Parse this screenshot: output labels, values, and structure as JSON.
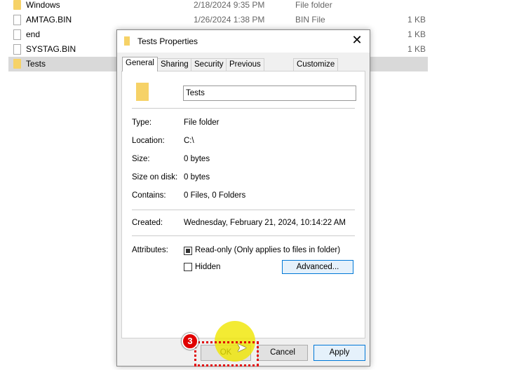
{
  "explorer": {
    "rows": [
      {
        "name": "Windows",
        "date": "2/18/2024 9:35 PM",
        "type": "File folder",
        "size": "",
        "icon": "folder-icon"
      },
      {
        "name": "AMTAG.BIN",
        "date": "1/26/2024 1:38 PM",
        "type": "BIN File",
        "size": "1 KB",
        "icon": "file-icon"
      },
      {
        "name": "end",
        "date": "",
        "type": "",
        "size": "1 KB",
        "icon": "file-icon"
      },
      {
        "name": "SYSTAG.BIN",
        "date": "",
        "type": "",
        "size": "1 KB",
        "icon": "file-icon"
      },
      {
        "name": "Tests",
        "date": "",
        "type": "",
        "size": "",
        "icon": "folder-icon",
        "selected": true
      }
    ]
  },
  "dialog": {
    "title": "Tests Properties",
    "tabs": [
      "General",
      "Sharing",
      "Security",
      "Previous Versions",
      "Customize"
    ],
    "name_value": "Tests",
    "type_label": "Type:",
    "type_value": "File folder",
    "location_label": "Location:",
    "location_value": "C:\\",
    "size_label": "Size:",
    "size_value": "0 bytes",
    "size_disk_label": "Size on disk:",
    "size_disk_value": "0 bytes",
    "contains_label": "Contains:",
    "contains_value": "0 Files, 0 Folders",
    "created_label": "Created:",
    "created_value": "Wednesday, February 21, 2024, 10:14:22 AM",
    "attributes_label": "Attributes:",
    "readonly_label": "Read-only (Only applies to files in folder)",
    "readonly_checked": "indeterminate",
    "hidden_label": "Hidden",
    "hidden_checked": false,
    "advanced_label": "Advanced...",
    "ok_label": "OK",
    "cancel_label": "Cancel",
    "apply_label": "Apply"
  },
  "annotation": {
    "step": "3"
  }
}
